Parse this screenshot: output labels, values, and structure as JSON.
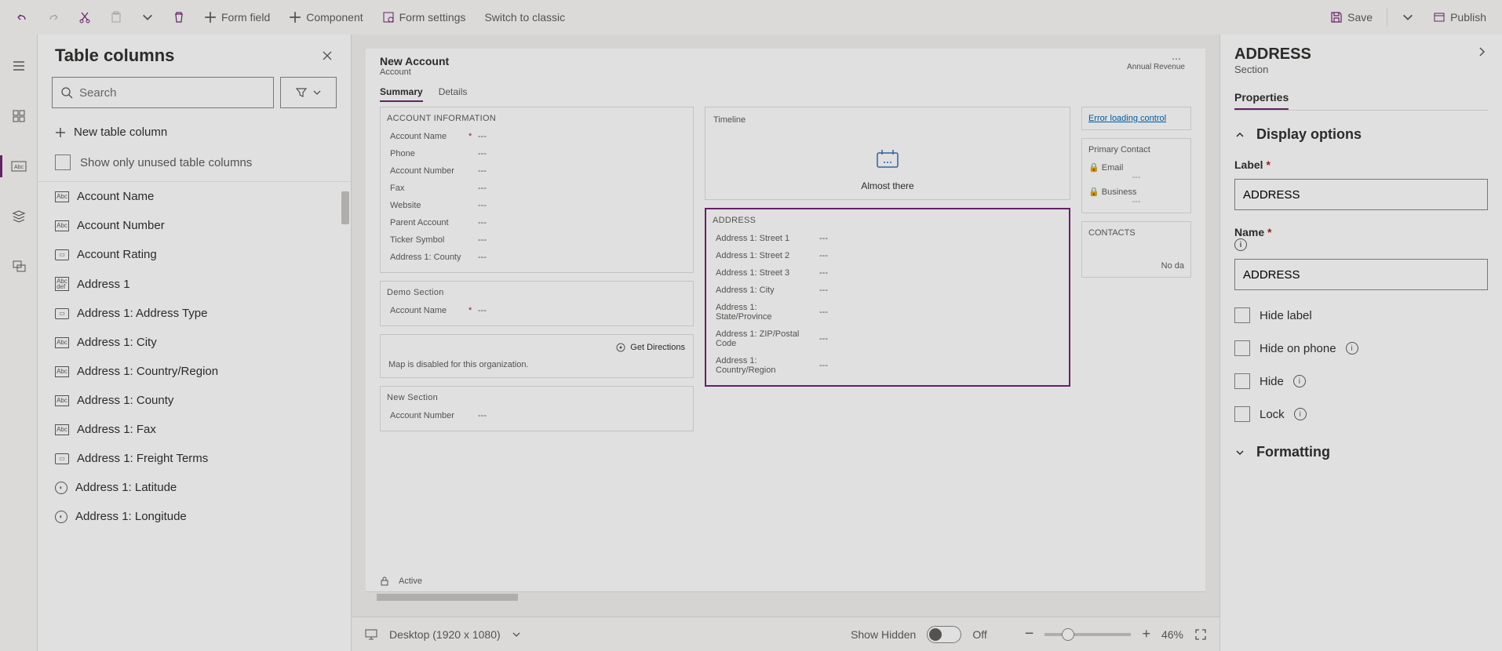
{
  "toolbar": {
    "form_field": "Form field",
    "component": "Component",
    "form_settings": "Form settings",
    "switch_classic": "Switch to classic",
    "save": "Save",
    "publish": "Publish"
  },
  "panel": {
    "title": "Table columns",
    "search_placeholder": "Search",
    "new_column": "New table column",
    "show_unused": "Show only unused table columns",
    "columns": [
      {
        "type": "Abc",
        "label": "Account Name"
      },
      {
        "type": "Abc",
        "label": "Account Number"
      },
      {
        "type": "opt",
        "label": "Account Rating"
      },
      {
        "type": "Abcdef",
        "label": "Address 1"
      },
      {
        "type": "opt",
        "label": "Address 1: Address Type"
      },
      {
        "type": "Abc",
        "label": "Address 1: City"
      },
      {
        "type": "Abc",
        "label": "Address 1: Country/Region"
      },
      {
        "type": "Abc",
        "label": "Address 1: County"
      },
      {
        "type": "Abc",
        "label": "Address 1: Fax"
      },
      {
        "type": "opt",
        "label": "Address 1: Freight Terms"
      },
      {
        "type": "geo",
        "label": "Address 1: Latitude"
      },
      {
        "type": "geo",
        "label": "Address 1: Longitude"
      }
    ]
  },
  "canvas": {
    "title": "New Account",
    "subtitle": "Account",
    "header_right": "Annual Revenue",
    "tabs": [
      "Summary",
      "Details"
    ],
    "account_info": {
      "header": "ACCOUNT INFORMATION",
      "fields": [
        {
          "label": "Account Name",
          "req": "*",
          "val": "---"
        },
        {
          "label": "Phone",
          "req": "",
          "val": "---"
        },
        {
          "label": "Account Number",
          "req": "",
          "val": "---"
        },
        {
          "label": "Fax",
          "req": "",
          "val": "---"
        },
        {
          "label": "Website",
          "req": "",
          "val": "---"
        },
        {
          "label": "Parent Account",
          "req": "",
          "val": "---"
        },
        {
          "label": "Ticker Symbol",
          "req": "",
          "val": "---"
        },
        {
          "label": "Address 1: County",
          "req": "",
          "val": "---"
        }
      ]
    },
    "demo": {
      "header": "Demo Section",
      "fields": [
        {
          "label": "Account Name",
          "req": "*",
          "val": "---"
        }
      ]
    },
    "map": {
      "get_directions": "Get Directions",
      "disabled": "Map is disabled for this organization."
    },
    "new_section": {
      "header": "New Section",
      "fields": [
        {
          "label": "Account Number",
          "req": "",
          "val": "---"
        }
      ]
    },
    "timeline": {
      "header": "Timeline",
      "text": "Almost there"
    },
    "address": {
      "header": "ADDRESS",
      "fields": [
        {
          "label": "Address 1: Street 1",
          "val": "---"
        },
        {
          "label": "Address 1: Street 2",
          "val": "---"
        },
        {
          "label": "Address 1: Street 3",
          "val": "---"
        },
        {
          "label": "Address 1: City",
          "val": "---"
        },
        {
          "label": "Address 1: State/Province",
          "val": "---"
        },
        {
          "label": "Address 1: ZIP/Postal Code",
          "val": "---"
        },
        {
          "label": "Address 1: Country/Region",
          "val": "---"
        }
      ]
    },
    "right": {
      "error": "Error loading control",
      "primary_contact": "Primary Contact",
      "email": "Email",
      "business": "Business",
      "contacts": "CONTACTS",
      "nodata": "No da"
    },
    "status": "Active",
    "footer": {
      "device": "Desktop (1920 x 1080)",
      "show_hidden": "Show Hidden",
      "off": "Off",
      "zoom": "46%"
    }
  },
  "props": {
    "title": "ADDRESS",
    "subtitle": "Section",
    "tab": "Properties",
    "display_options": "Display options",
    "label_label": "Label",
    "label_value": "ADDRESS",
    "name_label": "Name",
    "name_value": "ADDRESS",
    "hide_label": "Hide label",
    "hide_phone": "Hide on phone",
    "hide": "Hide",
    "lock": "Lock",
    "formatting": "Formatting"
  }
}
